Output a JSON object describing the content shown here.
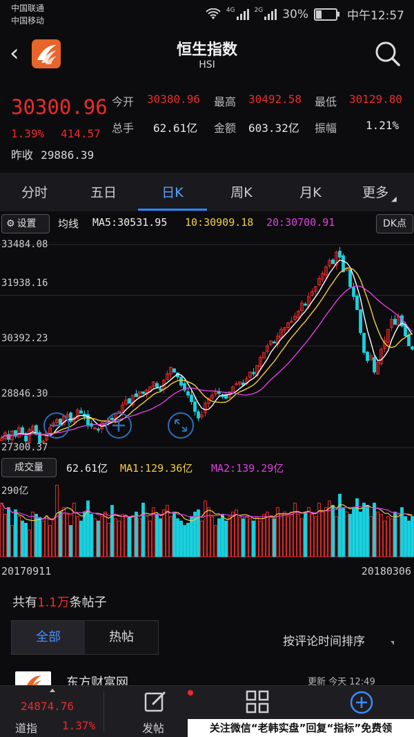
{
  "status_bar": {
    "carrier1": "中国联通",
    "carrier2": "中国移动",
    "network1": "4G",
    "network2": "2G",
    "battery": "30%",
    "battery_level": 0.3,
    "time": "中午12:57"
  },
  "header": {
    "title": "恒生指数",
    "subtitle": "HSI"
  },
  "quote": {
    "price": "30300.96",
    "change_pct": "1.39%",
    "change": "414.57",
    "prev_close_label": "昨收",
    "prev_close": "29886.39",
    "open_label": "今开",
    "open": "30380.96",
    "high_label": "最高",
    "high": "30492.58",
    "low_label": "最低",
    "low": "30129.80",
    "volume_label": "总手",
    "volume": "62.61亿",
    "amount_label": "金额",
    "amount": "603.32亿",
    "amplitude_label": "振幅",
    "amplitude": "1.21%"
  },
  "tabs": [
    {
      "label": "分时"
    },
    {
      "label": "五日"
    },
    {
      "label": "日K"
    },
    {
      "label": "周K"
    },
    {
      "label": "月K"
    },
    {
      "label": "更多"
    }
  ],
  "active_tab": 2,
  "ma_bar": {
    "settings_label": "设置",
    "label": "均线",
    "ma5": "MA5:30531.95",
    "ma10": "10:30909.18",
    "ma20": "20:30700.91",
    "dk_label": "DK点"
  },
  "chart_data": [
    {
      "type": "candlestick",
      "y_ticks": [
        "33484.08",
        "31938.16",
        "30392.23",
        "28846.30",
        "27300.37"
      ],
      "ylim": [
        27300.37,
        33484.08
      ],
      "x_start": "20170911",
      "x_end": "20180306",
      "close": [
        27600,
        27750,
        27550,
        27800,
        27650,
        27900,
        27700,
        27500,
        27850,
        27950,
        27700,
        27450,
        27500,
        27750,
        27900,
        28050,
        28150,
        28000,
        28250,
        28300,
        28100,
        28200,
        28450,
        28350,
        28250,
        28000,
        27950,
        27900,
        27850,
        28050,
        28100,
        28200,
        28150,
        28350,
        28400,
        28600,
        28750,
        28650,
        28900,
        28850,
        29000,
        28950,
        29050,
        29150,
        29300,
        29150,
        29050,
        29350,
        29550,
        29750,
        29600,
        29450,
        29200,
        29050,
        28900,
        28700,
        28400,
        28200,
        28300,
        28650,
        28800,
        28900,
        29000,
        28950,
        28850,
        28800,
        29000,
        29150,
        29250,
        29300,
        29200,
        29400,
        29600,
        29550,
        29800,
        30050,
        30200,
        30400,
        30550,
        30500,
        30700,
        30900,
        30950,
        31100,
        31150,
        31300,
        31450,
        31700,
        31650,
        31900,
        32050,
        32200,
        32450,
        32600,
        32800,
        33000,
        32900,
        33250,
        33100,
        32650,
        32750,
        32200,
        31900,
        31500,
        30800,
        30200,
        29950,
        30100,
        29600,
        29900,
        30300,
        30550,
        30900,
        31200,
        31050,
        31300,
        31000,
        30700,
        30400,
        30300
      ],
      "ma5": "MA5:30531.95",
      "ma10": "10:30909.18",
      "ma20": "20:30700.91"
    },
    {
      "type": "bar",
      "name": "volume",
      "y_max_label": "290亿",
      "total": "62.61亿",
      "ma1": "MA1:129.36亿",
      "ma2": "MA2:139.29亿",
      "values": [
        120,
        95,
        110,
        70,
        105,
        90,
        80,
        75,
        60,
        100,
        95,
        88,
        80,
        92,
        70,
        85,
        160,
        100,
        110,
        95,
        70,
        120,
        90,
        80,
        100,
        125,
        95,
        85,
        80,
        90,
        100,
        75,
        115,
        85,
        80,
        95,
        90,
        88,
        92,
        100,
        85,
        120,
        90,
        80,
        110,
        95,
        85,
        105,
        115,
        90,
        100,
        85,
        80,
        70,
        75,
        90,
        100,
        105,
        80,
        125,
        110,
        90,
        70,
        85,
        95,
        80,
        90,
        100,
        105,
        88,
        85,
        90,
        85,
        80,
        90,
        80,
        95,
        100,
        90,
        85,
        110,
        95,
        100,
        90,
        100,
        120,
        95,
        85,
        100,
        110,
        95,
        90,
        120,
        100,
        110,
        125,
        115,
        90,
        140,
        110,
        100,
        95,
        110,
        130,
        100,
        120,
        115,
        90,
        120,
        100,
        95,
        80,
        90,
        85,
        100,
        95,
        110,
        90,
        80,
        90
      ]
    }
  ],
  "volume_bar": {
    "label": "成交量",
    "total": "62.61亿",
    "ma1": "MA1:129.36亿",
    "ma2": "MA2:139.29亿"
  },
  "dates": {
    "start": "20170911",
    "end": "20180306"
  },
  "posts": {
    "prefix": "共有",
    "count": "1.1万",
    "suffix": "条帖子",
    "tab_all": "全部",
    "tab_hot": "热帖",
    "sort_label": "按评论时间排序",
    "first_author": "东方财富网",
    "first_time": "更新 今天 12:49"
  },
  "bottom_bar": {
    "index_value": "24874.76",
    "index_name": "道指",
    "index_pct": "1.37%",
    "post_label": "发帖",
    "watermark": "关注微信“老韩实盘”回复“指标”免费领"
  },
  "colors": {
    "up": "#ee2a2a",
    "down": "#19d3e0",
    "ma5": "#ffffff",
    "ma10": "#f4d03f",
    "ma20": "#e040e0",
    "accent": "#2d86ff"
  }
}
